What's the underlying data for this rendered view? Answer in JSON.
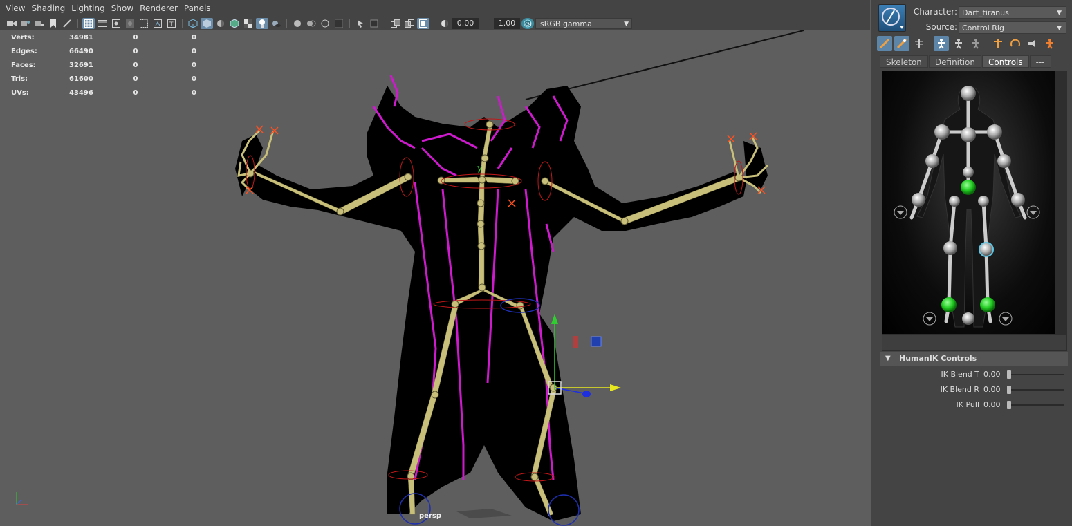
{
  "viewport": {
    "menu": [
      "View",
      "Shading",
      "Lighting",
      "Show",
      "Renderer",
      "Panels"
    ],
    "toolbar": {
      "exposure_value": "0.00",
      "gamma_value": "1.00",
      "color_space": "sRGB gamma"
    },
    "hud": {
      "rows": [
        {
          "label": "Verts:",
          "v1": "34981",
          "v2": "0",
          "v3": "0"
        },
        {
          "label": "Edges:",
          "v1": "66490",
          "v2": "0",
          "v3": "0"
        },
        {
          "label": "Faces:",
          "v1": "32691",
          "v2": "0",
          "v3": "0"
        },
        {
          "label": "Tris:",
          "v1": "61600",
          "v2": "0",
          "v3": "0"
        },
        {
          "label": "UVs:",
          "v1": "43496",
          "v2": "0",
          "v3": "0"
        }
      ]
    },
    "camera_label": "persp"
  },
  "hik": {
    "character_label": "Character:",
    "character_value": "Dart_tiranus",
    "source_label": "Source:",
    "source_value": "Control Rig",
    "tabs": [
      {
        "label": "Skeleton",
        "active": false
      },
      {
        "label": "Definition",
        "active": false
      },
      {
        "label": "Controls",
        "active": true
      },
      {
        "label": "---",
        "active": false
      }
    ],
    "controls_header": "HumanIK Controls",
    "sliders": [
      {
        "label": "IK Blend T",
        "value": "0.00"
      },
      {
        "label": "IK Blend R",
        "value": "0.00"
      },
      {
        "label": "IK Pull",
        "value": "0.00"
      }
    ]
  },
  "colors": {
    "viewport_bg": "#5e5e5e",
    "panel_bg": "#444444",
    "joint_color": "#c8c07a",
    "rig_curve_color": "#cc1acc",
    "selected_tool": "#5d85a8",
    "hik_active_effector": "#22c022"
  }
}
